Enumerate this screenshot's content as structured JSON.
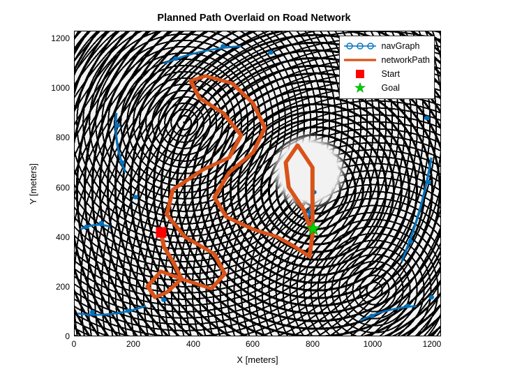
{
  "title": "Planned Path Overlaid on Road Network",
  "xlabel": "X [meters]",
  "ylabel": "Y [meters]",
  "legend": {
    "navGraph": "navGraph",
    "networkPath": "networkPath",
    "start": "Start",
    "goal": "Goal"
  },
  "xticks": [
    "0",
    "200",
    "400",
    "600",
    "800",
    "1000",
    "1200"
  ],
  "yticks": [
    "0",
    "200",
    "400",
    "600",
    "800",
    "1000",
    "1200"
  ],
  "colors": {
    "navGraph": "#0072BD",
    "networkPath": "#D95319",
    "start": "#FF0000",
    "goal": "#00D000"
  },
  "chart_data": {
    "type": "line",
    "title": "Planned Path Overlaid on Road Network",
    "xlabel": "X [meters]",
    "ylabel": "Y [meters]",
    "xlim": [
      0,
      1230
    ],
    "ylim": [
      0,
      1230
    ],
    "series": [
      {
        "name": "navGraph",
        "style": "blue line with circle markers (road network graph edges)",
        "description": "Dense road-network graph covering much of the open-pit mine terraces; individual node coordinates not readable from image."
      },
      {
        "name": "networkPath",
        "style": "thick orange polyline",
        "x": [
          290,
          300,
          330,
          360,
          310,
          270,
          245,
          290,
          370,
          460,
          505,
          470,
          370,
          310,
          330,
          430,
          520,
          560,
          500,
          420,
          390,
          440,
          530,
          600,
          640,
          600,
          520,
          470,
          510,
          600,
          680,
          740,
          790,
          800,
          770,
          720,
          710,
          750,
          800,
          800
        ],
        "y": [
          420,
          360,
          300,
          230,
          175,
          155,
          200,
          260,
          225,
          190,
          250,
          330,
          400,
          490,
          590,
          670,
          720,
          810,
          900,
          960,
          1030,
          1050,
          1020,
          940,
          840,
          740,
          660,
          560,
          480,
          430,
          400,
          360,
          320,
          410,
          510,
          600,
          700,
          770,
          680,
          440
        ]
      }
    ],
    "markers": {
      "Start": {
        "x": 290,
        "y": 425,
        "symbol": "red square"
      },
      "Goal": {
        "x": 800,
        "y": 435,
        "symbol": "green pentagram"
      }
    }
  }
}
